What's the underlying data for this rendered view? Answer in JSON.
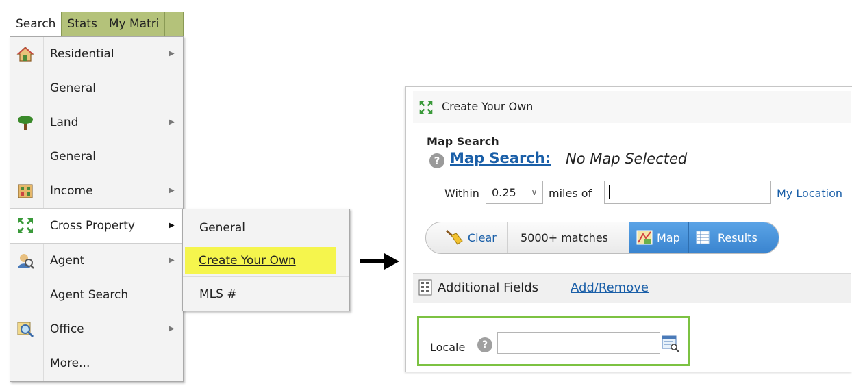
{
  "menu": {
    "tabs": [
      "Search",
      "Stats",
      "My Matri"
    ],
    "items": [
      {
        "label": "Residential",
        "icon": "house-icon",
        "arrow": "▶"
      },
      {
        "label": "General"
      },
      {
        "label": "Land",
        "icon": "tree-icon",
        "arrow": "▶"
      },
      {
        "label": "General"
      },
      {
        "label": "Income",
        "icon": "income-building-icon",
        "arrow": "▶"
      },
      {
        "label": "Cross Property",
        "icon": "expand-arrows-icon",
        "arrow": "▶"
      },
      {
        "label": "Agent",
        "icon": "agent-icon",
        "arrow": "▶"
      },
      {
        "label": "Agent Search"
      },
      {
        "label": "Office",
        "icon": "office-magnifier-icon",
        "arrow": "▶"
      },
      {
        "label": "More..."
      }
    ]
  },
  "submenu": {
    "items": [
      "General",
      "Create Your Own",
      "MLS #"
    ],
    "highlight_color": "#f5f54d"
  },
  "panel": {
    "title": "Create Your Own",
    "map_section_title": "Map Search",
    "map_search_link": "Map Search:",
    "map_status": "No Map Selected",
    "within_label": "Within",
    "radius_value": "0.25",
    "miles_label": "miles of",
    "location_value": "",
    "my_location": "My Location",
    "buttons": {
      "clear": "Clear",
      "matches": "5000+ matches",
      "map": "Map",
      "results": "Results"
    },
    "additional_fields": "Additional Fields",
    "add_remove": "Add/Remove",
    "locale_label": "Locale",
    "locale_value": ""
  },
  "colors": {
    "tab_bar": "#b4c27a",
    "link": "#1a5fa8",
    "toggle_active": "#3a84cf",
    "locale_highlight": "#7cc242"
  }
}
